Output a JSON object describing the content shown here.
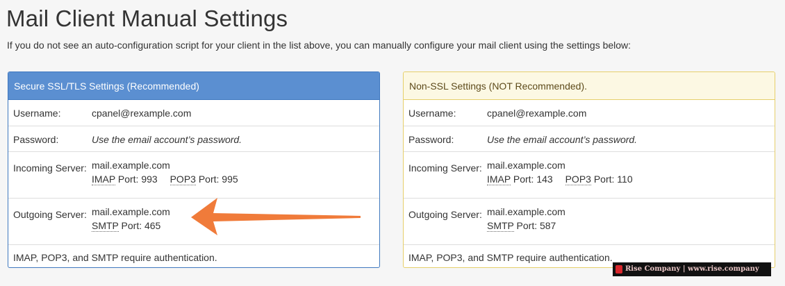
{
  "page": {
    "title": "Mail Client Manual Settings",
    "intro": "If you do not see an auto-configuration script for your client in the list above, you can manually configure your mail client using the settings below:"
  },
  "secure": {
    "heading": "Secure SSL/TLS Settings (Recommended)",
    "username_label": "Username:",
    "username": "cpanel@rexample.com",
    "password_label": "Password:",
    "password": "Use the email account’s password.",
    "incoming_label": "Incoming Server:",
    "incoming_host": "mail.example.com",
    "imap": "IMAP",
    "imap_port": "Port: 993",
    "pop3": "POP3",
    "pop3_port": "Port: 995",
    "outgoing_label": "Outgoing Server:",
    "outgoing_host": "mail.example.com",
    "smtp": "SMTP",
    "smtp_port": "Port: 465",
    "note": "IMAP, POP3, and SMTP require authentication."
  },
  "nonssl": {
    "heading": "Non-SSL Settings (NOT Recommended).",
    "username_label": "Username:",
    "username": "cpanel@rexample.com",
    "password_label": "Password:",
    "password": "Use the email account’s password.",
    "incoming_label": "Incoming Server:",
    "incoming_host": "mail.example.com",
    "imap": "IMAP",
    "imap_port": "Port: 143",
    "pop3": "POP3",
    "pop3_port": "Port: 110",
    "outgoing_label": "Outgoing Server:",
    "outgoing_host": "mail.example.com",
    "smtp": "SMTP",
    "smtp_port": "Port: 587",
    "note": "IMAP, POP3, and SMTP require authentication."
  },
  "annotation": {
    "arrow_color": "#f07b3a",
    "icon": "arrow-left-icon"
  },
  "watermark": {
    "text": "Rise Company | www.rise.company",
    "logo_color": "#d9262c"
  },
  "colors": {
    "secure_header": "#5b8fd1",
    "nonssl_header": "#fcf8e3",
    "nonssl_border": "#e6cf6a"
  }
}
